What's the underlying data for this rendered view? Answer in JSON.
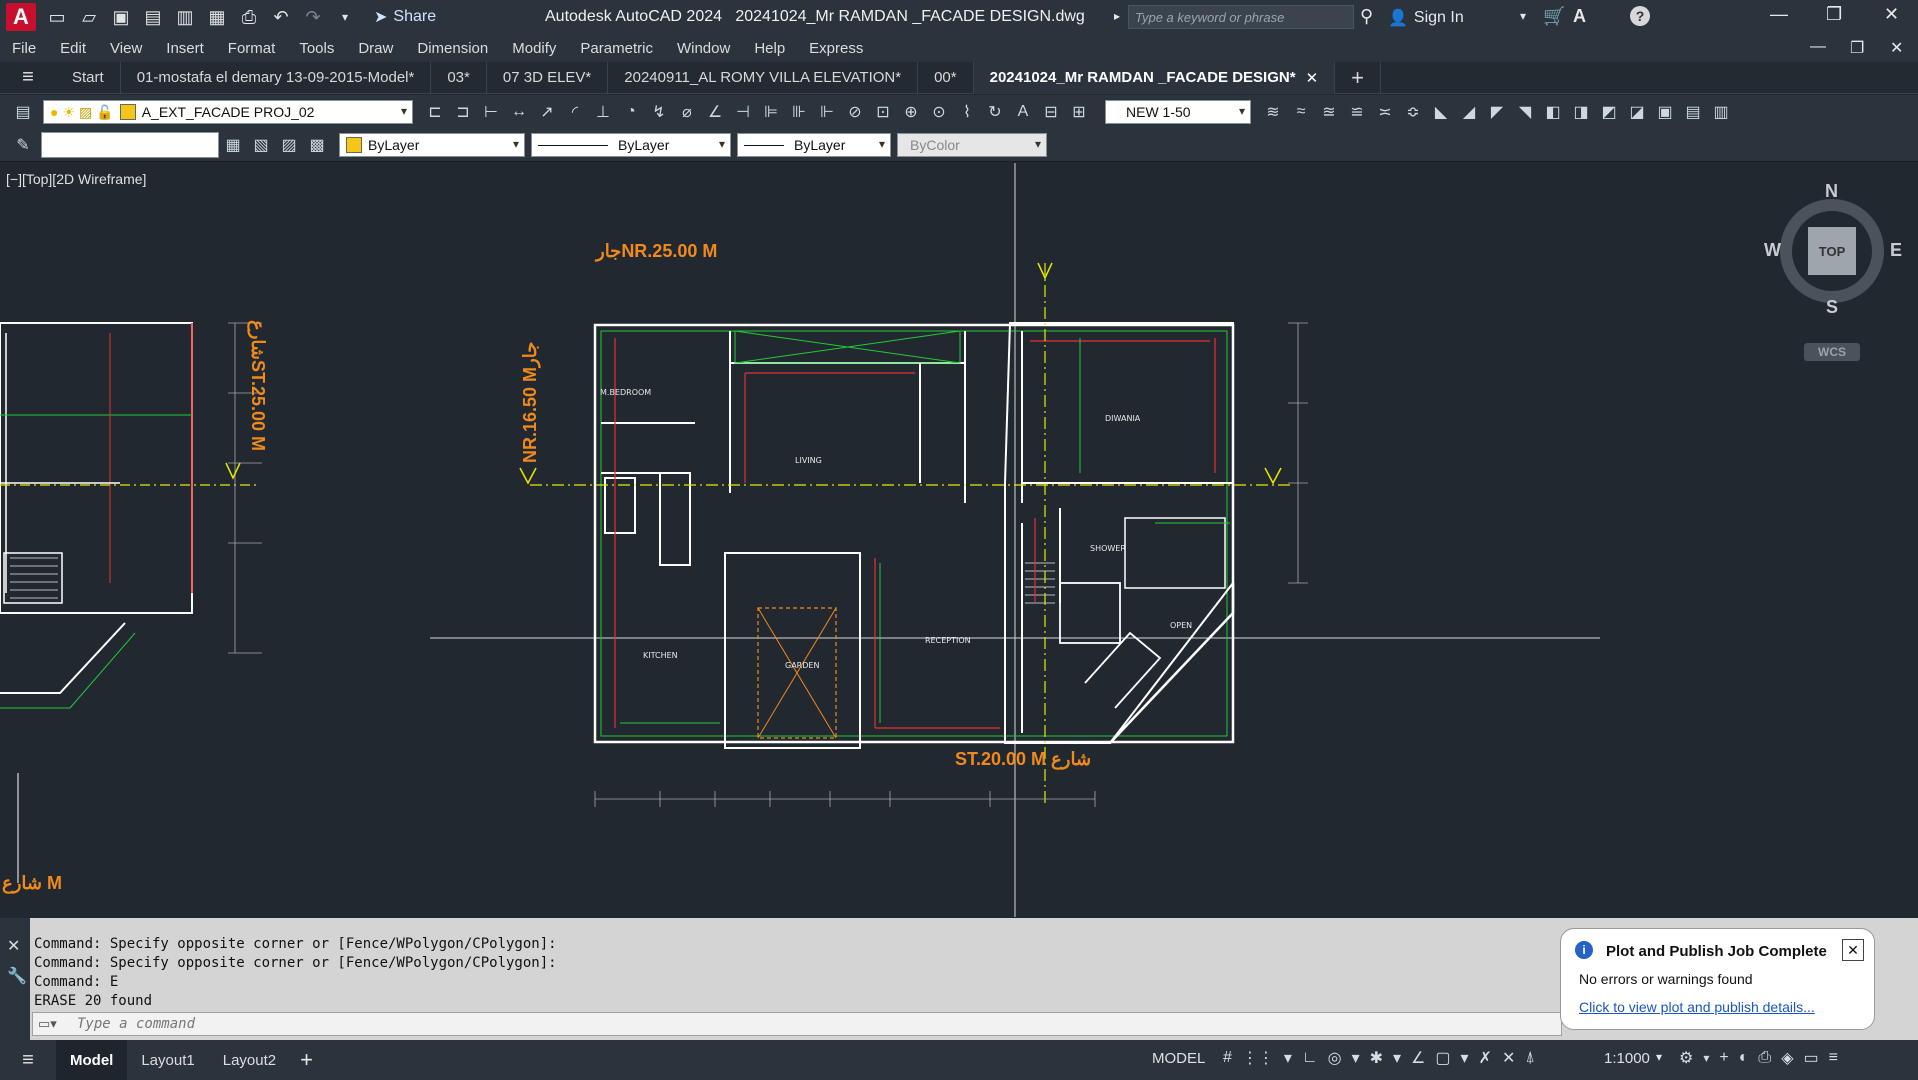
{
  "titlebar": {
    "logo": "A",
    "share_label": "Share",
    "app_title": "Autodesk AutoCAD 2024   20241024_Mr RAMDAN _FACADE DESIGN.dwg",
    "search_placeholder": "Type a keyword or phrase",
    "sign_in": "Sign In"
  },
  "menu": [
    "File",
    "Edit",
    "View",
    "Insert",
    "Format",
    "Tools",
    "Draw",
    "Dimension",
    "Modify",
    "Parametric",
    "Window",
    "Help",
    "Express"
  ],
  "tabs": [
    {
      "label": "Start",
      "active": false
    },
    {
      "label": "01-mostafa el demary 13-09-2015-Model*",
      "active": false
    },
    {
      "label": "03*",
      "active": false
    },
    {
      "label": "07 3D ELEV*",
      "active": false
    },
    {
      "label": "20240911_AL ROMY VILLA ELEVATION*",
      "active": false
    },
    {
      "label": "00*",
      "active": false
    },
    {
      "label": "20241024_Mr RAMDAN _FACADE DESIGN*",
      "active": true
    }
  ],
  "ribbon": {
    "layer_name": "A_EXT_FACADE PROJ_02",
    "annotation_scale": "NEW 1-50",
    "color": "ByLayer",
    "linetype": "ByLayer",
    "lineweight": "ByLayer",
    "plotstyle": "ByColor"
  },
  "viewport": {
    "label": "[−][Top][2D Wireframe]",
    "viewcube": {
      "n": "N",
      "s": "S",
      "e": "E",
      "w": "W",
      "face": "TOP",
      "wcs": "WCS"
    },
    "dims": {
      "neighbor": "جارNR.25.00  M",
      "neighbor_left": "NR.16.50 Mجار",
      "street": "ST.20.00  M  شارع",
      "street_left": "شارعST.25.00 M",
      "street_bottom_left": "شارع M"
    }
  },
  "command": {
    "lines": [
      "Command: Specify opposite corner or [Fence/WPolygon/CPolygon]:",
      "Command: Specify opposite corner or [Fence/WPolygon/CPolygon]:",
      "Command: E",
      "ERASE 20 found"
    ],
    "placeholder": "Type a command"
  },
  "status": {
    "tabs": [
      {
        "label": "Model",
        "active": true
      },
      {
        "label": "Layout1",
        "active": false
      },
      {
        "label": "Layout2",
        "active": false
      }
    ],
    "mode": "MODEL",
    "scale": "1:1000"
  },
  "notification": {
    "title": "Plot and Publish Job Complete",
    "message": "No errors or warnings found",
    "link": "Click to view plot and publish details..."
  },
  "colors": {
    "cad_bg": "#212830",
    "wall": "#ffffff",
    "green": "#22cc33",
    "red": "#e83030",
    "yellow": "#e8e800",
    "orange": "#f08a1c"
  }
}
